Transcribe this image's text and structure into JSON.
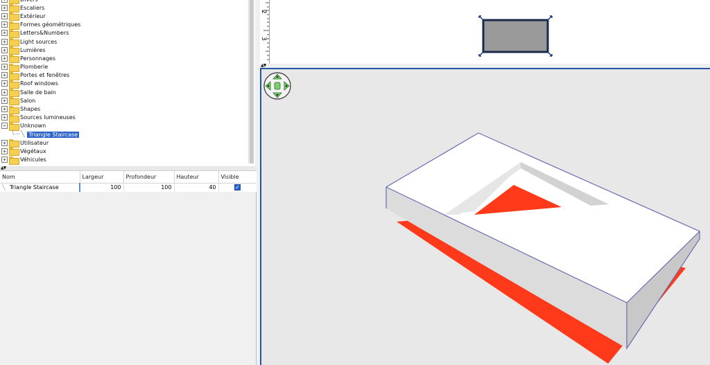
{
  "catalog": {
    "categories": [
      {
        "label": "Divers",
        "expanded": false
      },
      {
        "label": "Escaliers",
        "expanded": false
      },
      {
        "label": "Extérieur",
        "expanded": false
      },
      {
        "label": "Formes géométriques",
        "expanded": false
      },
      {
        "label": "Letters&Numbers",
        "expanded": false
      },
      {
        "label": "Light sources",
        "expanded": false
      },
      {
        "label": "Lumières",
        "expanded": false
      },
      {
        "label": "Personnages",
        "expanded": false
      },
      {
        "label": "Plomberie",
        "expanded": false
      },
      {
        "label": "Portes et fenêtres",
        "expanded": false
      },
      {
        "label": "Roof windows",
        "expanded": false
      },
      {
        "label": "Salle de bain",
        "expanded": false
      },
      {
        "label": "Salon",
        "expanded": false
      },
      {
        "label": "Shapes",
        "expanded": false
      },
      {
        "label": "Sources lumineuses",
        "expanded": false
      },
      {
        "label": "Unknown",
        "expanded": true
      },
      {
        "label": "Utilisateur",
        "expanded": false
      },
      {
        "label": "Végétaux",
        "expanded": false
      },
      {
        "label": "Véhicules",
        "expanded": false
      }
    ],
    "selected_item": "Triangle Staircase",
    "expand_symbol": "+",
    "collapse_symbol": "−"
  },
  "splitter_arrows": "▲▼",
  "furniture_table": {
    "columns": [
      "Nom",
      "Largeur",
      "Profondeur",
      "Hauteur",
      "Visible"
    ],
    "rows": [
      {
        "name": "Triangle Staircase",
        "width": "100",
        "depth": "100",
        "height": "40",
        "visible": true
      }
    ],
    "check_glyph": "✓"
  },
  "plan": {
    "ruler_labels": [
      "2",
      "3"
    ],
    "selection_fill": "#9a9a9a",
    "selection_border": "#1a2a4a"
  },
  "view3d": {
    "background": "#e8e8e8",
    "model_top": "#ffffff",
    "model_sides": "#dcdcdc",
    "accent_red": "#ff3a1a",
    "outline": "#6a6ab0",
    "nav_color": "#7ad06a"
  }
}
